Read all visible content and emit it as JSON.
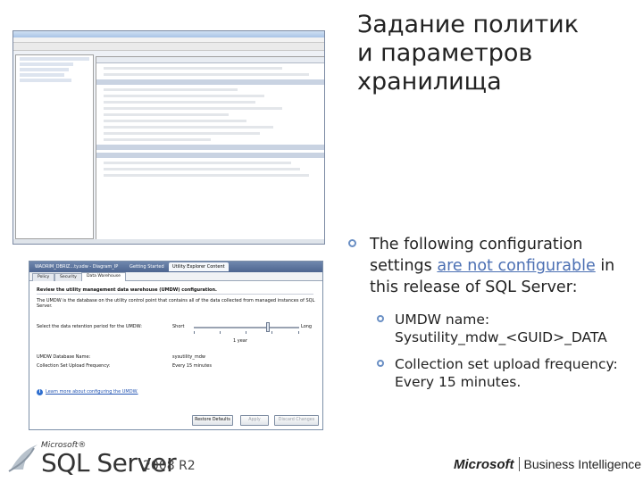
{
  "title": {
    "line1": "Задание политик",
    "line2": "и параметров",
    "line3": "хранилища"
  },
  "bullets": {
    "main_part1": "The following configuration settings ",
    "main_link": "are not configurable",
    "main_part2": " in this release of SQL Server:",
    "sub": [
      "UMDW name: Sysutility_mdw_<GUID>_DATA",
      "Collection set upload frequency: Every 15 minutes."
    ]
  },
  "dialog": {
    "tabs": [
      "WADRIM_DBRIZ...ty.sdw - Diagram_IP",
      "Getting Started",
      "Utility Explorer Content"
    ],
    "subtabs": [
      "Policy",
      "Security",
      "Data Warehouse"
    ],
    "heading": "Review the utility management data warehouse (UMDW) configuration.",
    "description": "The UMDW is the database on the utility control point that contains all of the data collected from managed instances of SQL Server.",
    "retention_label": "Select the data retention period for the UMDW:",
    "slider_min": "Short",
    "slider_max": "Long",
    "slider_value": "1 year",
    "slider_fraction": 0.7,
    "db_name_label": "UMDW Database Name:",
    "db_name_value": "sysutility_mdw",
    "upload_label": "Collection Set Upload Frequency:",
    "upload_value": "Every 15 minutes",
    "learn_link": "Learn more about configuring the UMDW.",
    "buttons": {
      "restore": "Restore Defaults",
      "apply": "Apply",
      "discard": "Discard Changes"
    }
  },
  "logos": {
    "ms_small": "Microsoft®",
    "sql_server": "SQL Server",
    "sql_version": "2008 R2",
    "ms_bi": "Microsoft",
    "business_intelligence": "Business Intelligence"
  }
}
